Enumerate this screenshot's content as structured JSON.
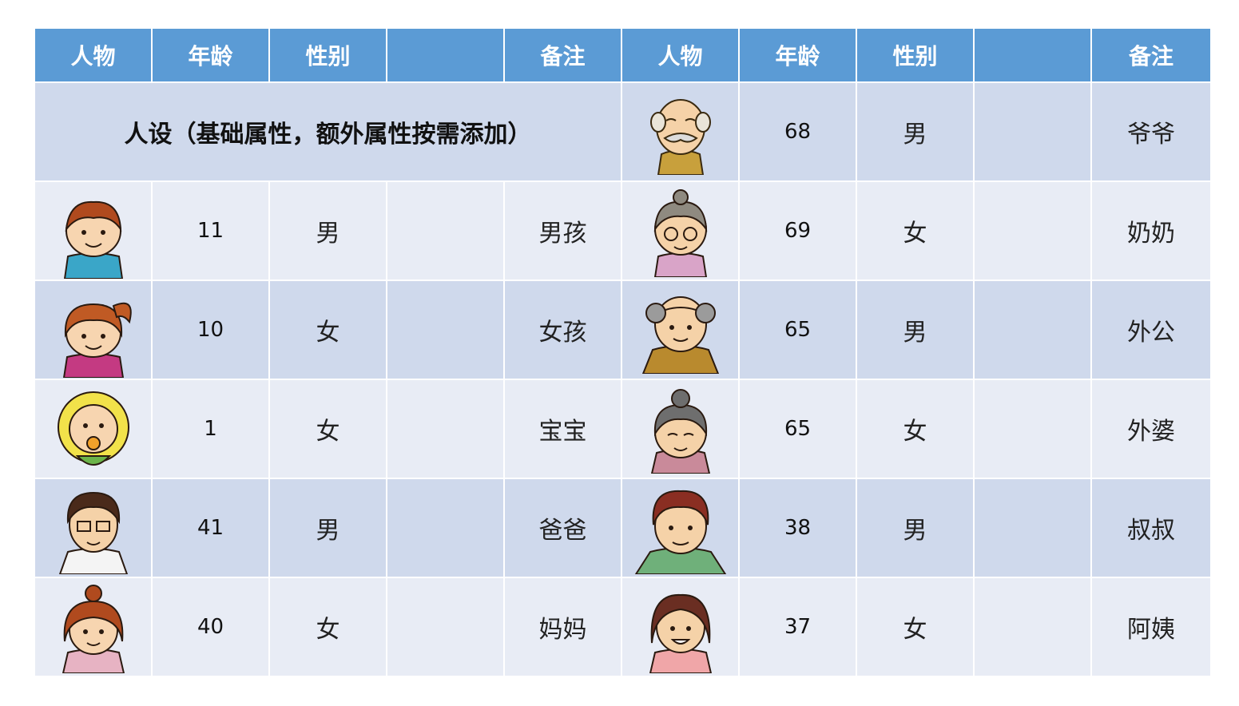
{
  "headers": [
    "人物",
    "年龄",
    "性别",
    "",
    "备注",
    "人物",
    "年龄",
    "性别",
    "",
    "备注"
  ],
  "title": "人设（基础属性，额外属性按需添加）",
  "left_people": [
    {
      "icon": "boy-avatar-icon",
      "age": "11",
      "gender": "男",
      "extra": "",
      "note": "男孩"
    },
    {
      "icon": "girl-avatar-icon",
      "age": "10",
      "gender": "女",
      "extra": "",
      "note": "女孩"
    },
    {
      "icon": "baby-avatar-icon",
      "age": "1",
      "gender": "女",
      "extra": "",
      "note": "宝宝"
    },
    {
      "icon": "father-avatar-icon",
      "age": "41",
      "gender": "男",
      "extra": "",
      "note": "爸爸"
    },
    {
      "icon": "mother-avatar-icon",
      "age": "40",
      "gender": "女",
      "extra": "",
      "note": "妈妈"
    }
  ],
  "right_people": [
    {
      "icon": "grandfather-avatar-icon",
      "age": "68",
      "gender": "男",
      "extra": "",
      "note": "爷爷"
    },
    {
      "icon": "grandmother-avatar-icon",
      "age": "69",
      "gender": "女",
      "extra": "",
      "note": "奶奶"
    },
    {
      "icon": "maternal-grandfather-avatar-icon",
      "age": "65",
      "gender": "男",
      "extra": "",
      "note": "外公"
    },
    {
      "icon": "maternal-grandmother-avatar-icon",
      "age": "65",
      "gender": "女",
      "extra": "",
      "note": "外婆"
    },
    {
      "icon": "uncle-avatar-icon",
      "age": "38",
      "gender": "男",
      "extra": "",
      "note": "叔叔"
    },
    {
      "icon": "aunt-avatar-icon",
      "age": "37",
      "gender": "女",
      "extra": "",
      "note": "阿姨"
    }
  ],
  "colors": {
    "header": "#5b9bd5",
    "row_dark": "#cfd9ec",
    "row_light": "#e8ecf5"
  }
}
